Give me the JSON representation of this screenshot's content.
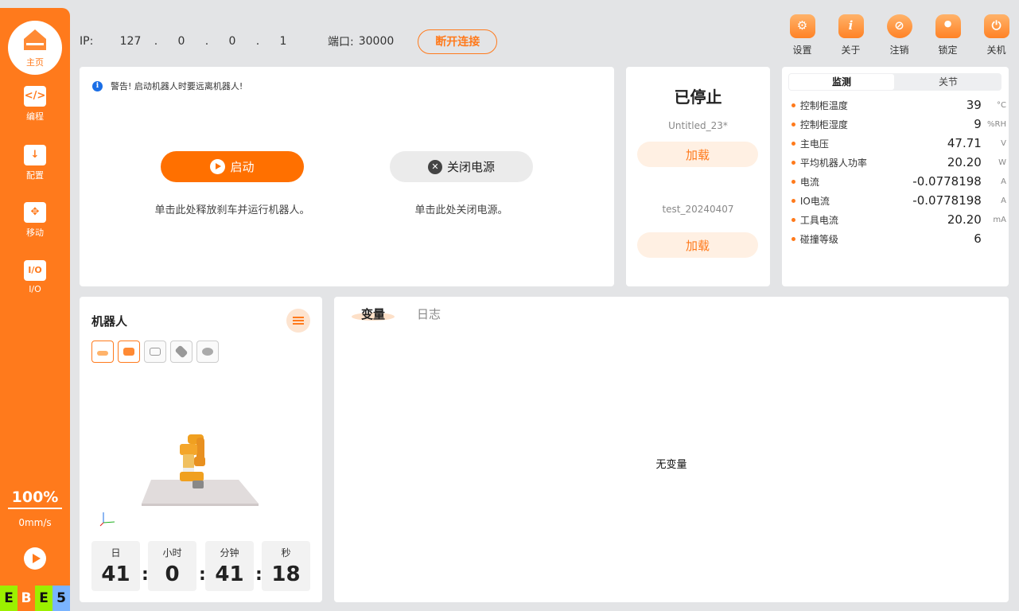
{
  "sidebar": {
    "home": "主页",
    "items": [
      {
        "label": "编程",
        "icon": "code-icon",
        "glyph": "</>"
      },
      {
        "label": "配置",
        "icon": "download-config-icon",
        "glyph": "↓"
      },
      {
        "label": "移动",
        "icon": "move-arrows-icon",
        "glyph": "✥"
      },
      {
        "label": "I/O",
        "icon": "io-icon",
        "glyph": "I/O"
      }
    ],
    "speed_percent": "100%",
    "speed": "0mm/s",
    "logo": [
      "E",
      "B",
      "E",
      "5"
    ],
    "logo_colors": [
      "#9bf000",
      "#ff7a1c",
      "#9bf000",
      "#7ab4ff"
    ]
  },
  "connection": {
    "ip_label": "IP:",
    "ip": [
      "127",
      "0",
      "0",
      "1"
    ],
    "ip_dot": ".",
    "port_label": "端口:",
    "port": "30000",
    "disconnect": "断开连接"
  },
  "toolbar": [
    {
      "label": "设置",
      "icon": "gear-icon",
      "glyph": "⚙"
    },
    {
      "label": "关于",
      "icon": "info-icon",
      "glyph": "i"
    },
    {
      "label": "注销",
      "icon": "logout-icon",
      "glyph": "⊘"
    },
    {
      "label": "锁定",
      "icon": "lock-icon",
      "glyph": "🔒"
    },
    {
      "label": "关机",
      "icon": "power-icon",
      "glyph": "⏻"
    }
  ],
  "control": {
    "warning": "警告! 启动机器人时要远离机器人!",
    "start": "启动",
    "start_hint": "单击此处释放刹车并运行机器人。",
    "power_off": "关闭电源",
    "power_hint": "单击此处关闭电源。"
  },
  "program": {
    "status": "已停止",
    "programs": [
      {
        "name": "Untitled_23*",
        "load": "加载"
      },
      {
        "name": "test_20240407",
        "load": "加载"
      }
    ]
  },
  "monitor": {
    "tabs": [
      "监测",
      "关节"
    ],
    "rows": [
      {
        "name": "控制柜温度",
        "value": "39",
        "unit": "°C"
      },
      {
        "name": "控制柜湿度",
        "value": "9",
        "unit": "%RH"
      },
      {
        "name": "主电压",
        "value": "47.71",
        "unit": "V"
      },
      {
        "name": "平均机器人功率",
        "value": "20.20",
        "unit": "W"
      },
      {
        "name": "电流",
        "value": "-0.0778198",
        "unit": "A"
      },
      {
        "name": "IO电流",
        "value": "-0.0778198",
        "unit": "A"
      },
      {
        "name": "工具电流",
        "value": "20.20",
        "unit": "mA"
      },
      {
        "name": "碰撞等级",
        "value": "6",
        "unit": ""
      }
    ]
  },
  "robot": {
    "title": "机器人",
    "time": [
      {
        "label": "日",
        "value": "41"
      },
      {
        "label": "小时",
        "value": "0"
      },
      {
        "label": "分钟",
        "value": "41"
      },
      {
        "label": "秒",
        "value": "18"
      }
    ],
    "separator": ":"
  },
  "variables": {
    "tabs": [
      "变量",
      "日志"
    ],
    "empty": "无变量"
  },
  "colors": {
    "accent": "#ff7a1c",
    "button": "#ff7000"
  }
}
